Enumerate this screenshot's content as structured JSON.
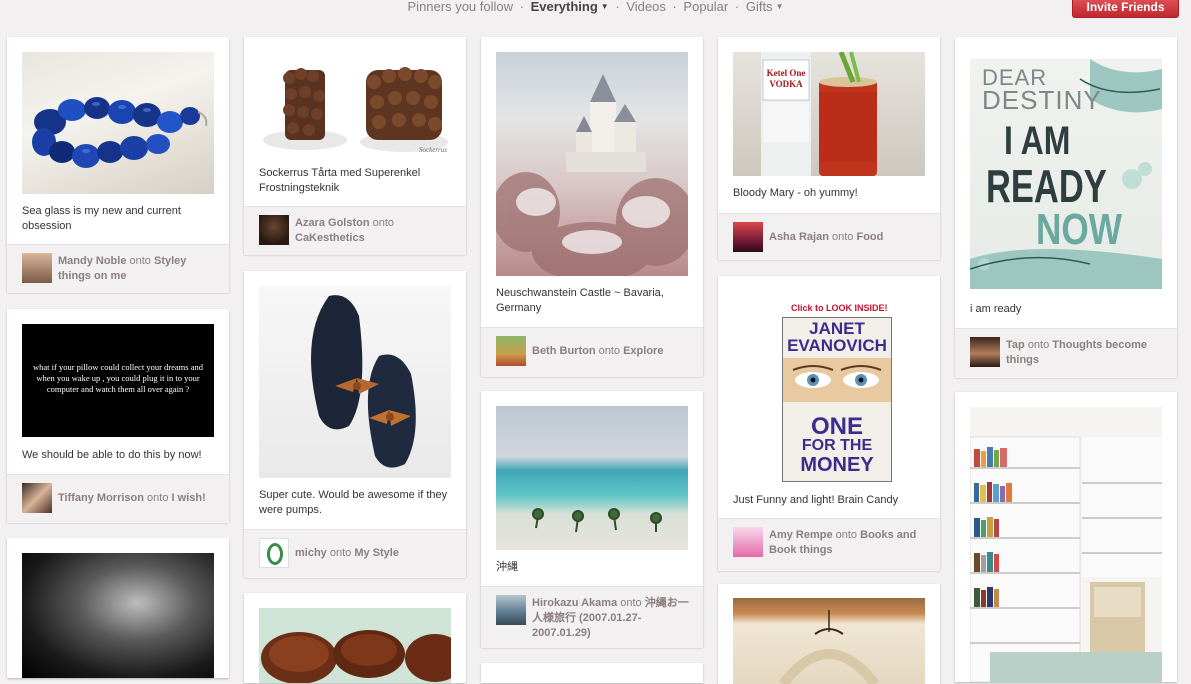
{
  "nav": {
    "following": "Pinners you follow",
    "everything": "Everything",
    "videos": "Videos",
    "popular": "Popular",
    "gifts": "Gifts",
    "separator": "·",
    "invite": "Invite Friends"
  },
  "colors": {
    "accent": "#c1272d",
    "background": "#f2f0f0",
    "attribution_text": "#8c7e7e"
  },
  "pins": {
    "p1": {
      "desc": "Sea glass is my new and current obsession",
      "user": "Mandy Noble",
      "onto": "onto",
      "board": "Styley things on me"
    },
    "p2": {
      "desc": "We should be able to do this by now!",
      "user": "Tiffany Morrison",
      "onto": "onto",
      "board": "I wish!",
      "image_text": "what if your pillow could collect your dreams and when you wake up , you could plug it in to your computer and watch them all over again ?"
    },
    "p4": {
      "desc": "Sockerrus Tårta med Superenkel Frostningsteknik",
      "user": "Azara Golston",
      "onto": "onto",
      "board": "CaKesthetics",
      "watermark": "Sockerrus"
    },
    "p5": {
      "desc": "Super cute. Would be awesome if they were pumps.",
      "user": "michy",
      "onto": "onto",
      "board": "My Style"
    },
    "p7": {
      "desc": "Neuschwanstein Castle ~ Bavaria, Germany",
      "user": "Beth Burton",
      "onto": "onto",
      "board": "Explore"
    },
    "p8": {
      "desc": "沖縄",
      "user": "Hirokazu Akama",
      "onto": "onto",
      "board": "沖縄お一人様旅行 (2007.01.27-2007.01.29)"
    },
    "p10": {
      "desc": "Bloody Mary - oh yummy!",
      "user": "Asha Rajan",
      "onto": "onto",
      "board": "Food",
      "bottle_label": "Ketel One VODKA"
    },
    "p11": {
      "desc": "Just Funny and light! Brain Candy",
      "user": "Amy Rempe",
      "onto": "onto",
      "board": "Books and Book things",
      "look_inside": "Click to LOOK INSIDE!",
      "author": "JANET EVANOVICH",
      "title1": "ONE",
      "title2": "FOR THE",
      "title3": "MONEY"
    },
    "p13": {
      "desc": "i am ready",
      "user": "Tap",
      "onto": "onto",
      "board": "Thoughts become things",
      "poster1": "DEAR",
      "poster2": "DESTINY",
      "poster3": "I AM",
      "poster4": "READY",
      "poster5": "NOW"
    }
  },
  "icons": [
    "caret-down-icon"
  ]
}
